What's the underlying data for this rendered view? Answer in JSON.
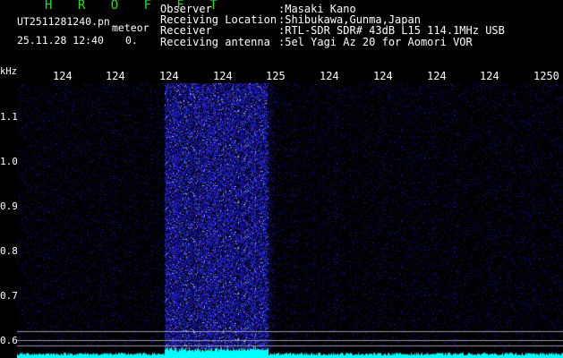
{
  "header": {
    "app_title": "H R O F F T",
    "filename": "UT2511281240.pn",
    "meteor_label": "meteor",
    "datetime": "25.11.28 12:40",
    "count": "0."
  },
  "info": [
    {
      "label": "Observer",
      "value": ":Masaki Kano"
    },
    {
      "label": "Receiving Location",
      "value": ":Shibukawa,Gunma,Japan"
    },
    {
      "label": "Receiver",
      "value": ":RTL-SDR SDR# 43dB L15 114.1MHz USB"
    },
    {
      "label": "Receiving antenna",
      "value": ":5el Yagi Az 20 for Aomori VOR"
    }
  ],
  "axes": {
    "y_unit": "kHz",
    "x_ticks": [
      "124",
      "124",
      "124",
      "124",
      "125",
      "124",
      "124",
      "124",
      "124",
      "1250"
    ],
    "y_ticks": [
      "1.1",
      "1.0",
      "0.9",
      "0.8",
      "0.7",
      "0.6"
    ]
  },
  "colors": {
    "background": "#000000",
    "title": "#22dd22",
    "signal_band": "#1a1aa8",
    "trace": "#00ffff"
  }
}
